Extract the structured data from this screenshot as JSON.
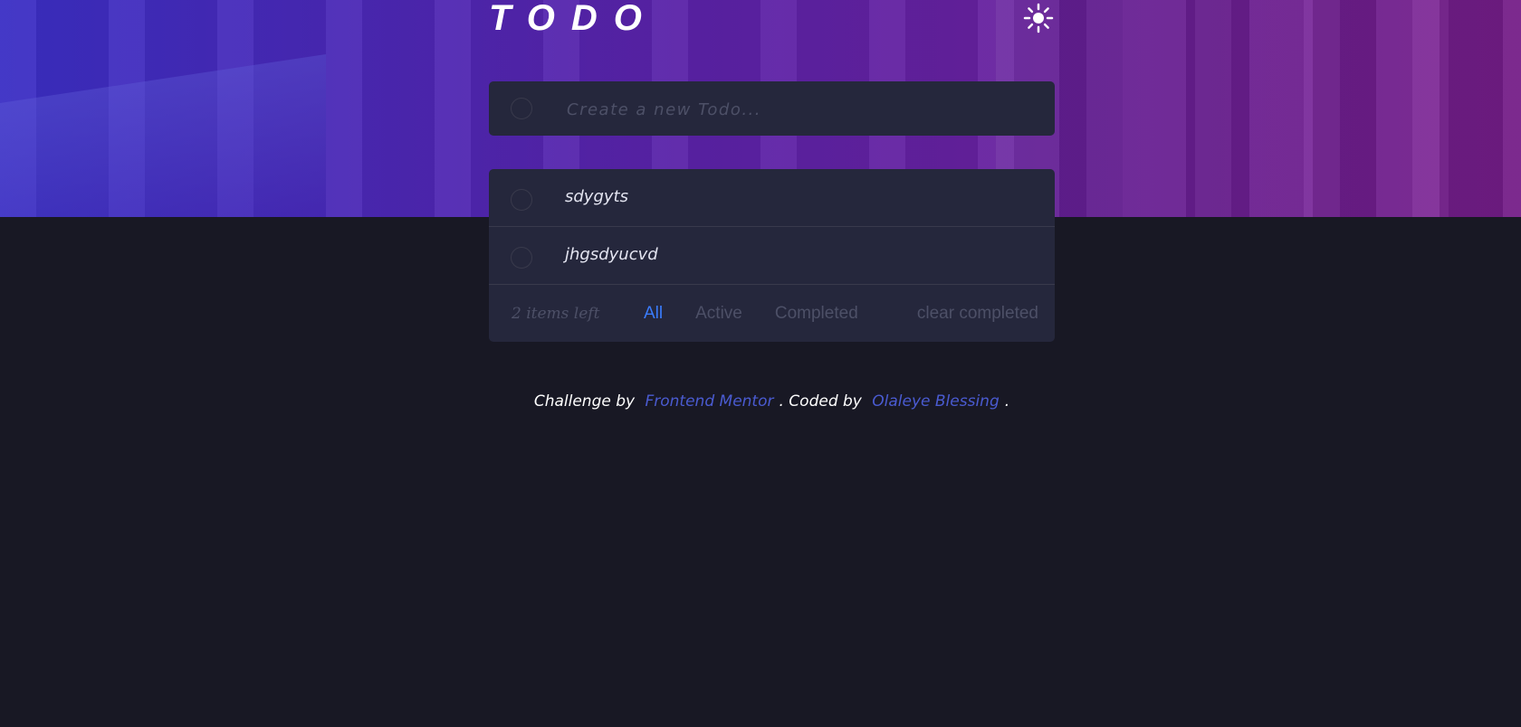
{
  "header": {
    "title": "TODO",
    "theme_icon": "sun-icon"
  },
  "new_todo": {
    "placeholder": "Create a new Todo..."
  },
  "todos": [
    {
      "text": "sdygyts",
      "completed": false
    },
    {
      "text": "jhgsdyucvd",
      "completed": false
    }
  ],
  "footer": {
    "items_left": "2 items left",
    "filters": [
      {
        "label": "All",
        "active": true
      },
      {
        "label": "Active",
        "active": false
      },
      {
        "label": "Completed",
        "active": false
      }
    ],
    "clear_label": "clear completed"
  },
  "attribution": {
    "prefix": "Challenge by",
    "link1": "Frontend Mentor",
    "middle": ". Coded by",
    "link2": "Olaleye Blessing",
    "suffix": "."
  },
  "colors": {
    "background": "#181824",
    "card": "#25273c",
    "accent": "#3a7cfd",
    "link": "#4a5bd1",
    "muted": "#4d5067"
  }
}
